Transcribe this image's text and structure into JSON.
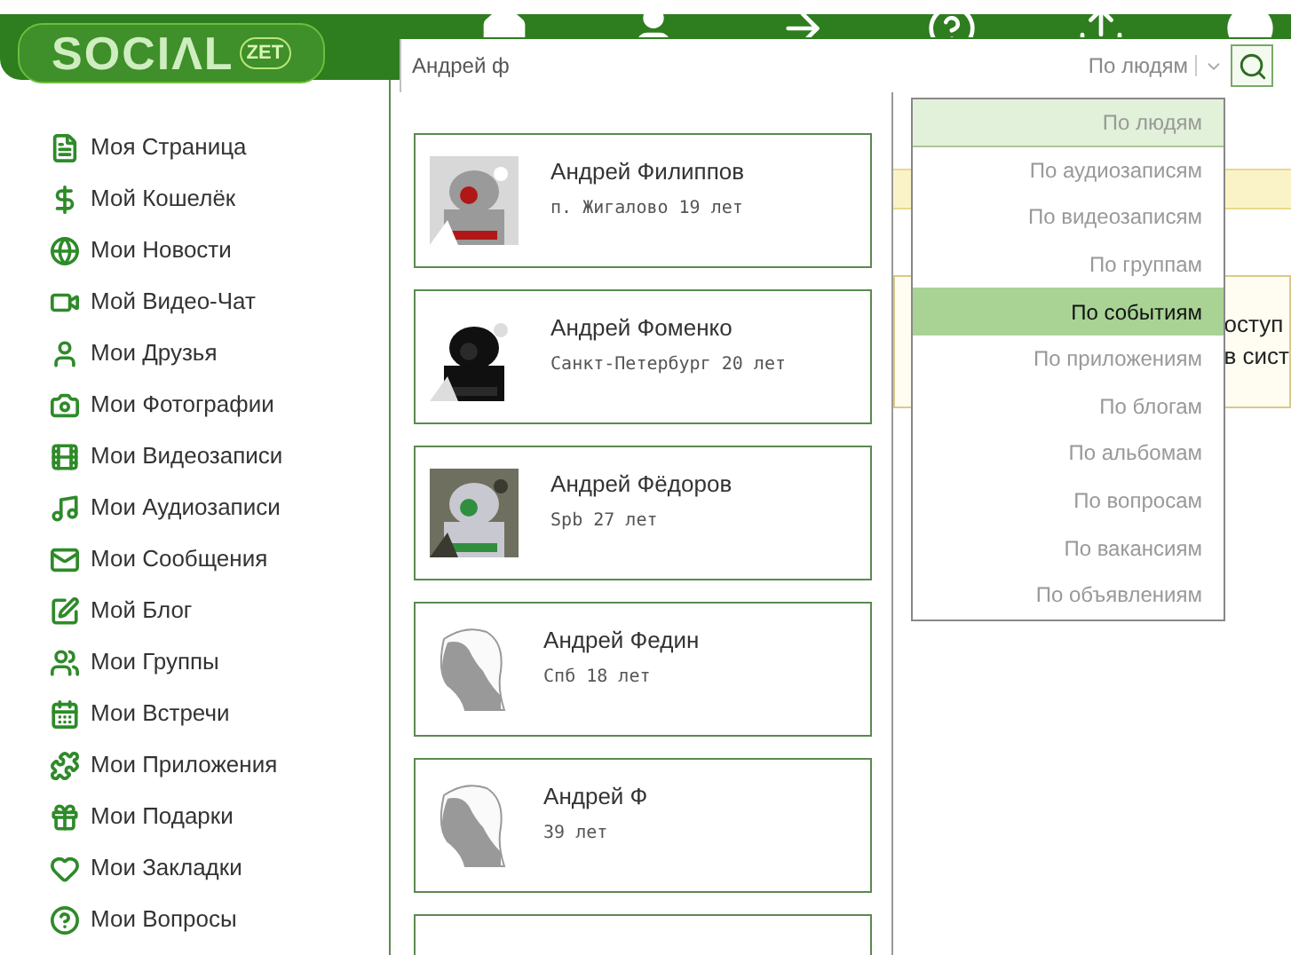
{
  "logo": {
    "main": "SOCIΛL",
    "badge": "ZET"
  },
  "search": {
    "value": "Андрей ф",
    "scope": "По людям"
  },
  "scope_menu": [
    {
      "label": "По людям",
      "selected": false,
      "current": true
    },
    {
      "label": "По аудиозаписям",
      "selected": false,
      "current": false
    },
    {
      "label": "По видеозаписям",
      "selected": false,
      "current": false
    },
    {
      "label": "По группам",
      "selected": false,
      "current": false
    },
    {
      "label": "По событиям",
      "selected": true,
      "current": false
    },
    {
      "label": "По приложениям",
      "selected": false,
      "current": false
    },
    {
      "label": "По блогам",
      "selected": false,
      "current": false
    },
    {
      "label": "По альбомам",
      "selected": false,
      "current": false
    },
    {
      "label": "По вопросам",
      "selected": false,
      "current": false
    },
    {
      "label": "По вакансиям",
      "selected": false,
      "current": false
    },
    {
      "label": "По объявлениям",
      "selected": false,
      "current": false
    }
  ],
  "sidebar": {
    "items": [
      {
        "label": "Моя Страница"
      },
      {
        "label": "Мой Кошелёк"
      },
      {
        "label": "Мои Новости"
      },
      {
        "label": "Мой Видео-Чат"
      },
      {
        "label": "Мои Друзья"
      },
      {
        "label": "Мои Фотографии"
      },
      {
        "label": "Мои Видеозаписи"
      },
      {
        "label": "Мои Аудиозаписи"
      },
      {
        "label": "Мои Сообщения"
      },
      {
        "label": "Мой Блог"
      },
      {
        "label": "Мои Группы"
      },
      {
        "label": "Мои Встречи"
      },
      {
        "label": "Мои Приложения"
      },
      {
        "label": "Мои Подарки"
      },
      {
        "label": "Мои Закладки"
      },
      {
        "label": "Мои Вопросы"
      }
    ]
  },
  "results": [
    {
      "name": "Андрей Филиппов",
      "details": "п. Жигалово  19 лет",
      "kind": "picture"
    },
    {
      "name": "Андрей Фоменко",
      "details": "Санкт-Петербург  20 лет",
      "kind": "picture"
    },
    {
      "name": "Андрей Фёдоров",
      "details": "Spb  27 лет",
      "kind": "picture"
    },
    {
      "name": "Андрей Федин",
      "details": "Спб  18 лет",
      "kind": "silhouette"
    },
    {
      "name": "Андрей Ф",
      "details": "39 лет",
      "kind": "silhouette"
    }
  ],
  "background_notice": [
    "оступ",
    "в сист"
  ]
}
